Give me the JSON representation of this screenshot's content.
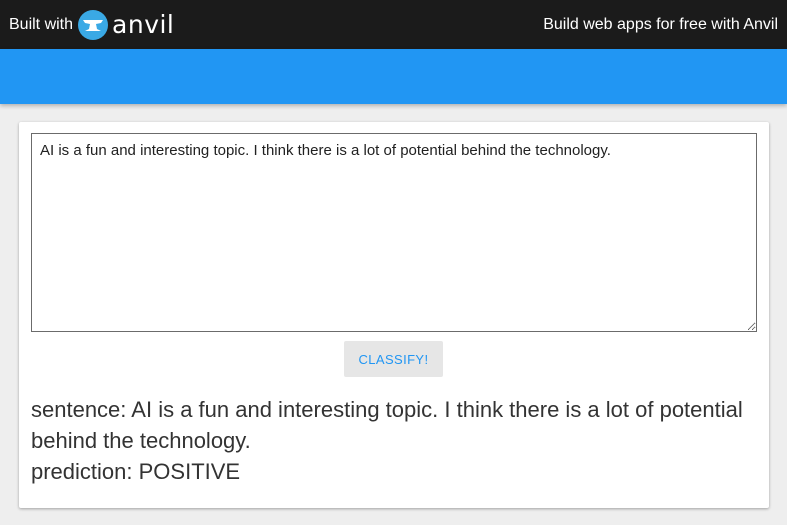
{
  "topbar": {
    "built_with": "Built with",
    "logo_word": "anvil",
    "promo": "Build web apps for free with Anvil"
  },
  "form": {
    "input_text": "AI is a fun and interesting topic. I think there is a lot of potential behind the technology.",
    "classify_label": "CLASSIFY!"
  },
  "result": {
    "sentence_line": "sentence: AI is a fun and interesting topic. I think there is a lot of potential behind the technology.",
    "prediction_line": "prediction: POSITIVE"
  },
  "colors": {
    "topbar": "#1b1b1b",
    "app_bar": "#2196f3",
    "accent": "#2196f3",
    "logo_circle": "#3aa9e5"
  },
  "icons": {
    "logo": "anvil-logo-icon"
  }
}
